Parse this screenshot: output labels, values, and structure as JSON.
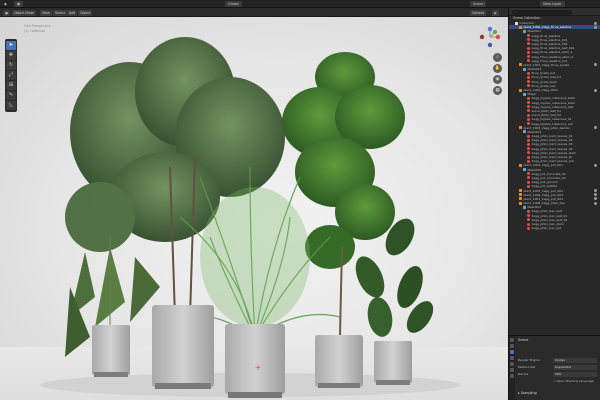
{
  "topbar": {
    "scene_label": "Scene",
    "view_layer_label": "View Layer",
    "mode_label": "Global"
  },
  "viewport_header": {
    "mode": "Object Mode",
    "menus": [
      "View",
      "Select",
      "Add",
      "Object"
    ],
    "options_label": "Options"
  },
  "viewport_info": {
    "line1": "User Perspective",
    "line2": "(1) Collection"
  },
  "toolbar": {
    "tools": [
      "cursor-tool",
      "move-tool",
      "rotate-tool",
      "scale-tool",
      "transform-tool",
      "annotate-tool",
      "measure-tool"
    ]
  },
  "outliner": {
    "search_placeholder": "",
    "title": "Scene Collection",
    "rows": [
      {
        "label": "Collection",
        "type": "col",
        "indent": 1,
        "selected": false
      },
      {
        "label": "plant_1000_2agg_Ficus_elastica",
        "type": "obj",
        "indent": 2,
        "selected": true
      },
      {
        "label": "Mesh001",
        "type": "mesh",
        "indent": 3,
        "selected": false
      },
      {
        "label": "zagg_ficus_elastica",
        "type": "mat",
        "indent": 4,
        "selected": false
      },
      {
        "label": "zagg_ficus_elastica_001",
        "type": "mat",
        "indent": 4,
        "selected": false
      },
      {
        "label": "zagg_ficus_elastica_002",
        "type": "mat",
        "indent": 4,
        "selected": false
      },
      {
        "label": "zagg_ficus_elastica_leaf_001",
        "type": "mat",
        "indent": 4,
        "selected": false
      },
      {
        "label": "zagg_ficus_elastica_stem_1",
        "type": "mat",
        "indent": 4,
        "selected": false
      },
      {
        "label": "zagg_Ficus_elastica_stem_2",
        "type": "mat",
        "indent": 4,
        "selected": false
      },
      {
        "label": "zagg_Ficus_elastica_pot",
        "type": "mat",
        "indent": 4,
        "selected": false
      },
      {
        "label": "plant_1001_2agg_Ficus_Lyrata",
        "type": "obj",
        "indent": 2,
        "selected": false
      },
      {
        "label": "Mesh002",
        "type": "mesh",
        "indent": 3,
        "selected": false
      },
      {
        "label": "ficus_lyrata_pot",
        "type": "mat",
        "indent": 4,
        "selected": false
      },
      {
        "label": "ficus_lyrata_leaf_01",
        "type": "mat",
        "indent": 4,
        "selected": false
      },
      {
        "label": "ficus_lyrata_bark",
        "type": "mat",
        "indent": 4,
        "selected": false
      },
      {
        "label": "ficus_lyrata_soil",
        "type": "mat",
        "indent": 4,
        "selected": false
      },
      {
        "label": "plant_1002_2agg_Palm",
        "type": "obj",
        "indent": 2,
        "selected": false
      },
      {
        "label": "Magic",
        "type": "mesh",
        "indent": 3,
        "selected": false
      },
      {
        "label": "2agg_Dypsis_lutescens_stem",
        "type": "mat",
        "indent": 4,
        "selected": false
      },
      {
        "label": "2agg_Dypsis_lutescens_stem",
        "type": "mat",
        "indent": 4,
        "selected": false
      },
      {
        "label": "2agg_Dypsis_lutescens_leaf",
        "type": "mat",
        "indent": 4,
        "selected": false
      },
      {
        "label": "areca_Palm_leaf_01",
        "type": "mat",
        "indent": 4,
        "selected": false
      },
      {
        "label": "areca_Palm_leaf_02",
        "type": "mat",
        "indent": 4,
        "selected": false
      },
      {
        "label": "2agg_Dypsis_lutescens_01",
        "type": "mat",
        "indent": 4,
        "selected": false
      },
      {
        "label": "2agg_Dypsis_lutescens_pot",
        "type": "mat",
        "indent": 4,
        "selected": false
      },
      {
        "label": "plant_1003_2agg_philo_bambo",
        "type": "obj",
        "indent": 2,
        "selected": false
      },
      {
        "label": "Mesh004",
        "type": "mesh",
        "indent": 3,
        "selected": false
      },
      {
        "label": "2agg_philo_bam_leaves_01",
        "type": "mat",
        "indent": 4,
        "selected": false
      },
      {
        "label": "2agg_philo_bam_leaves_02",
        "type": "mat",
        "indent": 4,
        "selected": false
      },
      {
        "label": "2agg_philo_bam_leaves_03",
        "type": "mat",
        "indent": 4,
        "selected": false
      },
      {
        "label": "2agg_philo_bam_leaves_04",
        "type": "mat",
        "indent": 4,
        "selected": false
      },
      {
        "label": "2agg_philo_bam_leaves_stem",
        "type": "mat",
        "indent": 4,
        "selected": false
      },
      {
        "label": "2agg_philo_bam_leaves_str",
        "type": "mat",
        "indent": 4,
        "selected": false
      },
      {
        "label": "2agg_philo_bam_leaves_pot",
        "type": "mat",
        "indent": 4,
        "selected": false
      },
      {
        "label": "plant_1004_2agg_pot_001",
        "type": "obj",
        "indent": 2,
        "selected": false
      },
      {
        "label": "Mesh005",
        "type": "mesh",
        "indent": 3,
        "selected": false
      },
      {
        "label": "2agg_pot_Concrete_01",
        "type": "mat",
        "indent": 4,
        "selected": false
      },
      {
        "label": "2agg_pot_Concrete_02",
        "type": "mat",
        "indent": 4,
        "selected": false
      },
      {
        "label": "2agg_pot_ground",
        "type": "mat",
        "indent": 4,
        "selected": false
      },
      {
        "label": "2agg_pot_pebble",
        "type": "mat",
        "indent": 4,
        "selected": false
      },
      {
        "label": "plant_1005_2agg_pot_002",
        "type": "obj",
        "indent": 2,
        "selected": false
      },
      {
        "label": "plant_1006_2agg_pot_003",
        "type": "obj",
        "indent": 2,
        "selected": false
      },
      {
        "label": "plant_1007_2agg_pot_004",
        "type": "obj",
        "indent": 2,
        "selected": false
      },
      {
        "label": "plant_1008_2agg_philo_bao",
        "type": "obj",
        "indent": 2,
        "selected": false
      },
      {
        "label": "Mesh003",
        "type": "mesh",
        "indent": 3,
        "selected": false
      },
      {
        "label": "2agg_philo_bao_leaf",
        "type": "mat",
        "indent": 4,
        "selected": false
      },
      {
        "label": "2agg_philo_bao_leaf_01",
        "type": "mat",
        "indent": 4,
        "selected": false
      },
      {
        "label": "2agg_philo_bao_leaf_02",
        "type": "mat",
        "indent": 4,
        "selected": false
      },
      {
        "label": "2agg_philo_bao_stem",
        "type": "mat",
        "indent": 4,
        "selected": false
      },
      {
        "label": "2agg_philo_bao_pot",
        "type": "mat",
        "indent": 4,
        "selected": false
      }
    ]
  },
  "properties": {
    "section": "Scene",
    "render_engine_label": "Render Engine",
    "render_engine_value": "Cycles",
    "feature_set_label": "Feature Set",
    "feature_set_value": "Supported",
    "device_label": "Device",
    "device_value": "CPU",
    "osl_label": "Open Shading Language",
    "sampling_label": "Sampling"
  },
  "colors": {
    "accent": "#4772b3",
    "object_icon": "#e38b2c",
    "mesh_icon": "#5fa8d3",
    "material_icon": "#d8534f"
  }
}
